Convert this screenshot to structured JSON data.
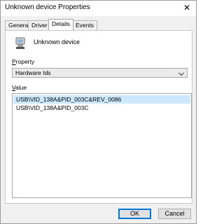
{
  "window": {
    "title": "Unknown device Properties",
    "close_glyph": "✕"
  },
  "tabs": [
    {
      "label": "General"
    },
    {
      "label": "Driver"
    },
    {
      "label": "Details"
    },
    {
      "label": "Events"
    }
  ],
  "active_tab": "Details",
  "device": {
    "name": "Unknown device",
    "icon": "usb-device-icon"
  },
  "property": {
    "label_prefix": "",
    "label_accel": "P",
    "label_rest": "roperty",
    "selected": "Hardware Ids"
  },
  "value": {
    "label_accel": "V",
    "label_rest": "alue",
    "items": [
      {
        "text": "USB\\VID_138A&PID_003C&REV_0086",
        "selected": true
      },
      {
        "text": "USB\\VID_138A&PID_003C",
        "selected": false
      }
    ]
  },
  "buttons": {
    "ok": "OK",
    "cancel": "Cancel"
  },
  "colors": {
    "selection": "#cce8ff",
    "accent": "#0078d7"
  }
}
